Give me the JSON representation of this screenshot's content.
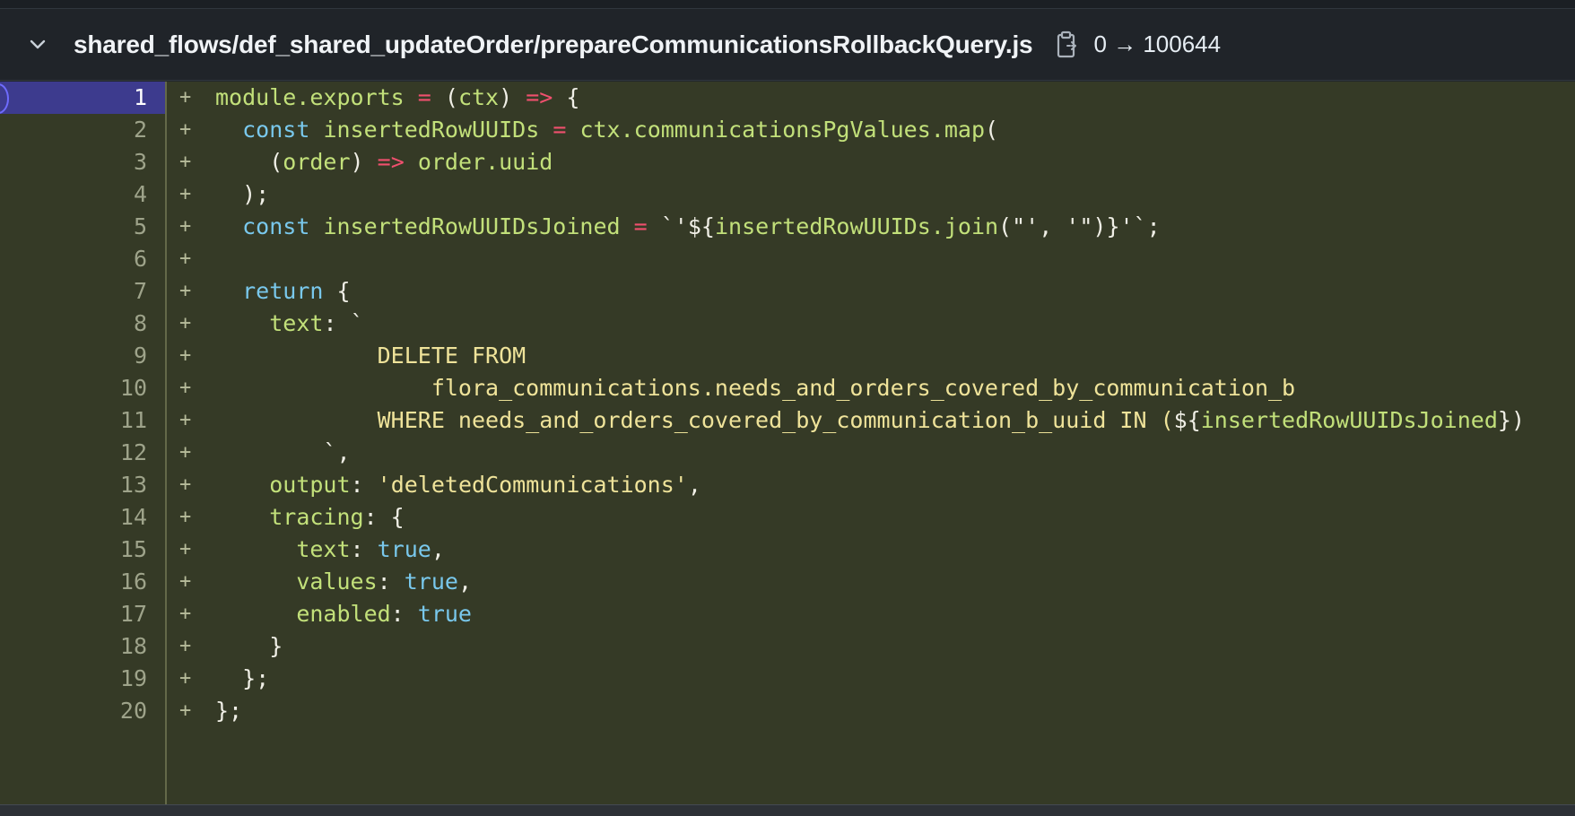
{
  "file": {
    "path": "shared_flows/def_shared_updateOrder/prepareCommunicationsRollbackQuery.js",
    "mode_change": "0 → 100644",
    "chevron_icon": "chevron-down-icon",
    "copy_icon": "copy-path-icon"
  },
  "diff": {
    "added_marker": "+",
    "selected_line": 1,
    "lines": [
      {
        "n": "1",
        "tokens": [
          [
            "module.exports",
            "id"
          ],
          [
            " ",
            "pn"
          ],
          [
            "=",
            "op"
          ],
          [
            " (",
            "pn"
          ],
          [
            "ctx",
            "id"
          ],
          [
            ") ",
            "pn"
          ],
          [
            "=>",
            "op"
          ],
          [
            " {",
            "pn"
          ]
        ]
      },
      {
        "n": "2",
        "tokens": [
          [
            "  ",
            "pn"
          ],
          [
            "const",
            "kw"
          ],
          [
            " ",
            "pn"
          ],
          [
            "insertedRowUUIDs",
            "id"
          ],
          [
            " ",
            "pn"
          ],
          [
            "=",
            "op"
          ],
          [
            " ",
            "pn"
          ],
          [
            "ctx.communicationsPgValues.map",
            "id"
          ],
          [
            "(",
            "pn"
          ]
        ]
      },
      {
        "n": "3",
        "tokens": [
          [
            "    (",
            "pn"
          ],
          [
            "order",
            "id"
          ],
          [
            ") ",
            "pn"
          ],
          [
            "=>",
            "op"
          ],
          [
            " ",
            "pn"
          ],
          [
            "order.uuid",
            "id"
          ]
        ]
      },
      {
        "n": "4",
        "tokens": [
          [
            "  );",
            "pn"
          ]
        ]
      },
      {
        "n": "5",
        "tokens": [
          [
            "  ",
            "pn"
          ],
          [
            "const",
            "kw"
          ],
          [
            " ",
            "pn"
          ],
          [
            "insertedRowUUIDsJoined",
            "id"
          ],
          [
            " ",
            "pn"
          ],
          [
            "=",
            "op"
          ],
          [
            " `'${",
            "pn"
          ],
          [
            "insertedRowUUIDs.join",
            "id"
          ],
          [
            "(\"', '\")}'`;",
            "pn"
          ]
        ]
      },
      {
        "n": "6",
        "tokens": []
      },
      {
        "n": "7",
        "tokens": [
          [
            "  ",
            "pn"
          ],
          [
            "return",
            "kw"
          ],
          [
            " {",
            "pn"
          ]
        ]
      },
      {
        "n": "8",
        "tokens": [
          [
            "    ",
            "pn"
          ],
          [
            "text",
            "id"
          ],
          [
            ": `",
            "pn"
          ]
        ]
      },
      {
        "n": "9",
        "tokens": [
          [
            "            DELETE FROM",
            "sql"
          ]
        ]
      },
      {
        "n": "10",
        "tokens": [
          [
            "                flora_communications.needs_and_orders_covered_by_communication_b",
            "sql"
          ]
        ]
      },
      {
        "n": "11",
        "tokens": [
          [
            "            WHERE needs_and_orders_covered_by_communication_b_uuid IN (",
            "sql"
          ],
          [
            "${",
            "pn"
          ],
          [
            "insertedRowUUIDsJoined",
            "id"
          ],
          [
            "})",
            "pn"
          ]
        ]
      },
      {
        "n": "12",
        "tokens": [
          [
            "        `,",
            "pn"
          ]
        ]
      },
      {
        "n": "13",
        "tokens": [
          [
            "    ",
            "pn"
          ],
          [
            "output",
            "id"
          ],
          [
            ": ",
            "pn"
          ],
          [
            "'deletedCommunications'",
            "str"
          ],
          [
            ",",
            "pn"
          ]
        ]
      },
      {
        "n": "14",
        "tokens": [
          [
            "    ",
            "pn"
          ],
          [
            "tracing",
            "id"
          ],
          [
            ": {",
            "pn"
          ]
        ]
      },
      {
        "n": "15",
        "tokens": [
          [
            "      ",
            "pn"
          ],
          [
            "text",
            "id"
          ],
          [
            ": ",
            "pn"
          ],
          [
            "true",
            "kw"
          ],
          [
            ",",
            "pn"
          ]
        ]
      },
      {
        "n": "16",
        "tokens": [
          [
            "      ",
            "pn"
          ],
          [
            "values",
            "id"
          ],
          [
            ": ",
            "pn"
          ],
          [
            "true",
            "kw"
          ],
          [
            ",",
            "pn"
          ]
        ]
      },
      {
        "n": "17",
        "tokens": [
          [
            "      ",
            "pn"
          ],
          [
            "enabled",
            "id"
          ],
          [
            ": ",
            "pn"
          ],
          [
            "true",
            "kw"
          ]
        ]
      },
      {
        "n": "18",
        "tokens": [
          [
            "    }",
            "pn"
          ]
        ]
      },
      {
        "n": "19",
        "tokens": [
          [
            "  };",
            "pn"
          ]
        ]
      },
      {
        "n": "20",
        "tokens": [
          [
            "};",
            "pn"
          ]
        ]
      }
    ]
  },
  "colors": {
    "added_background": "#353a26",
    "selected_line_number": "#3d3b8e",
    "keyword": "#79c8ec",
    "identifier": "#c2e07a",
    "operator": "#f0506e",
    "string": "#efe39a"
  }
}
